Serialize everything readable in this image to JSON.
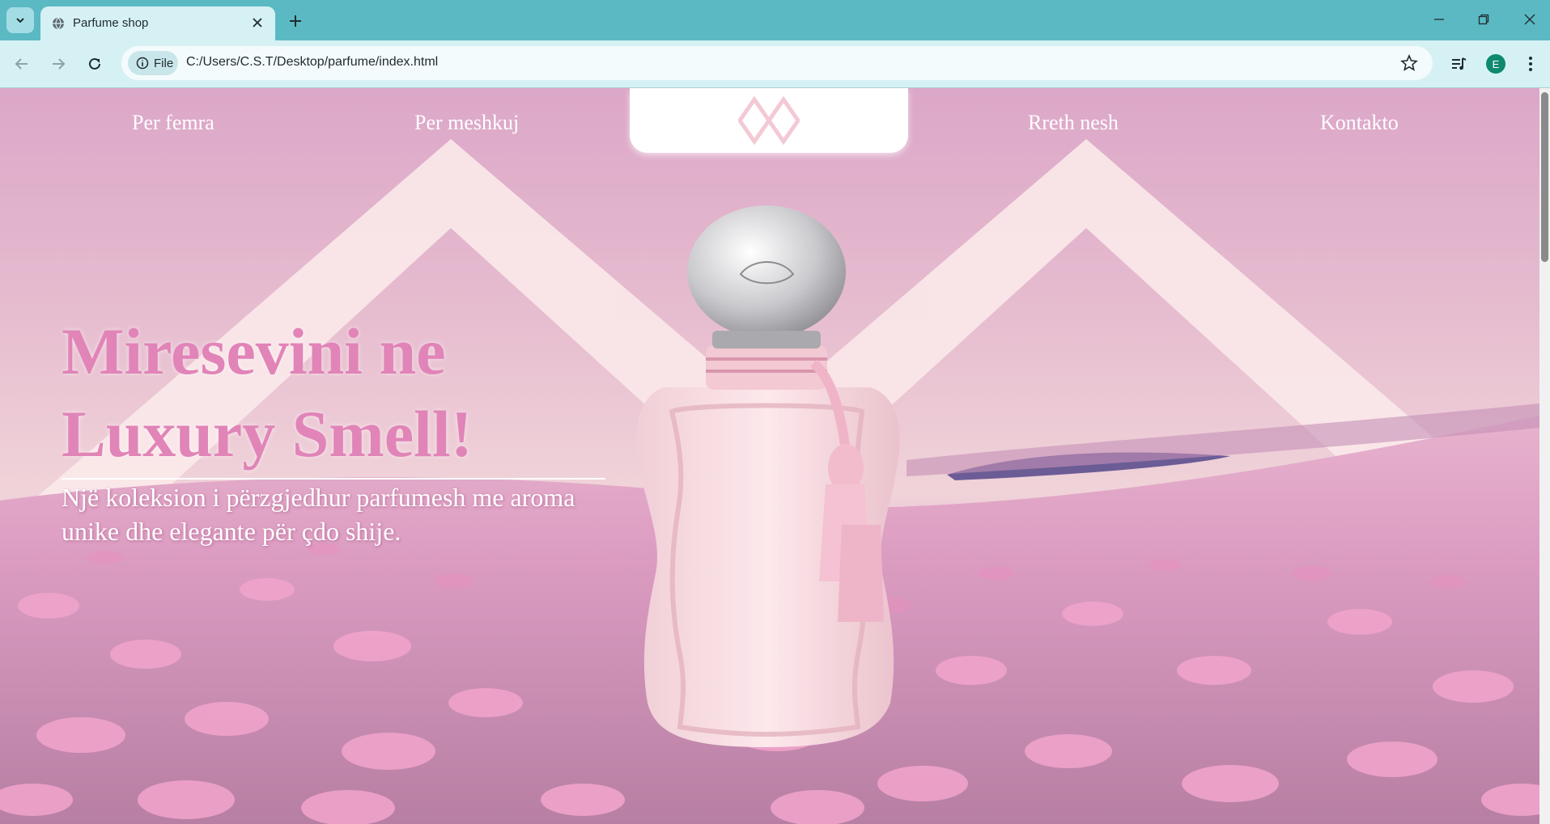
{
  "browser": {
    "tab_title": "Parfume shop",
    "security_chip": "File",
    "url": "C:/Users/C.S.T/Desktop/parfume/index.html",
    "profile_initial": "E"
  },
  "nav": {
    "items": [
      {
        "label": "Per femra"
      },
      {
        "label": "Per meshkuj"
      },
      {
        "label": "Rreth nesh"
      },
      {
        "label": "Kontakto"
      }
    ]
  },
  "hero": {
    "headline": "Miresevini ne Luxury Smell!",
    "subtitle": "Një koleksion i përzgjedhur parfumesh me aroma unike dhe elegante për çdo shije."
  },
  "colors": {
    "browser_frame": "#5bb9c4",
    "toolbar": "#d6f1f4",
    "page_pink": "#dca7c8",
    "headline_pink": "#e184b8",
    "logo_pink": "#f3c9d4"
  }
}
